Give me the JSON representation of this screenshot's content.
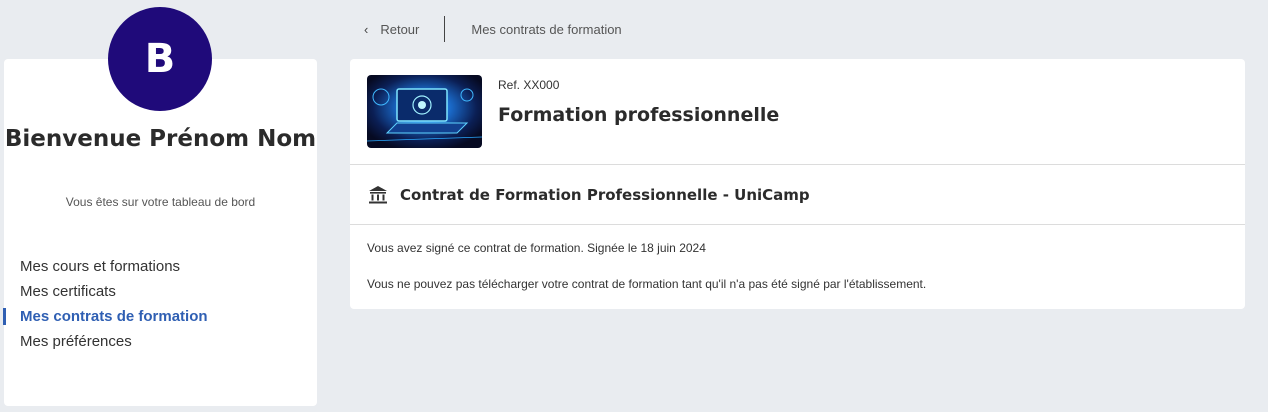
{
  "user": {
    "avatar_letter": "B",
    "welcome": "Bienvenue Prénom Nom",
    "subtitle": "Vous êtes sur votre tableau de bord"
  },
  "nav": {
    "items": [
      {
        "label": "Mes cours et formations",
        "active": false
      },
      {
        "label": "Mes certificats",
        "active": false
      },
      {
        "label": "Mes contrats de formation",
        "active": true
      },
      {
        "label": "Mes préférences",
        "active": false
      }
    ]
  },
  "breadcrumb": {
    "back_label": "Retour",
    "current": "Mes contrats de formation"
  },
  "course": {
    "ref": "Ref. XX000",
    "title": "Formation professionnelle"
  },
  "contract": {
    "title": "Contrat de Formation Professionnelle - UniCamp",
    "signed_text": "Vous avez signé ce contrat de formation. Signée le 18 juin 2024",
    "download_notice": "Vous ne pouvez pas télécharger votre contrat de formation tant qu'il n'a pas été signé par l'établissement."
  },
  "colors": {
    "accent": "#2f5fb3",
    "avatar_bg": "#1f0a7a",
    "background": "#e9ecf0"
  }
}
